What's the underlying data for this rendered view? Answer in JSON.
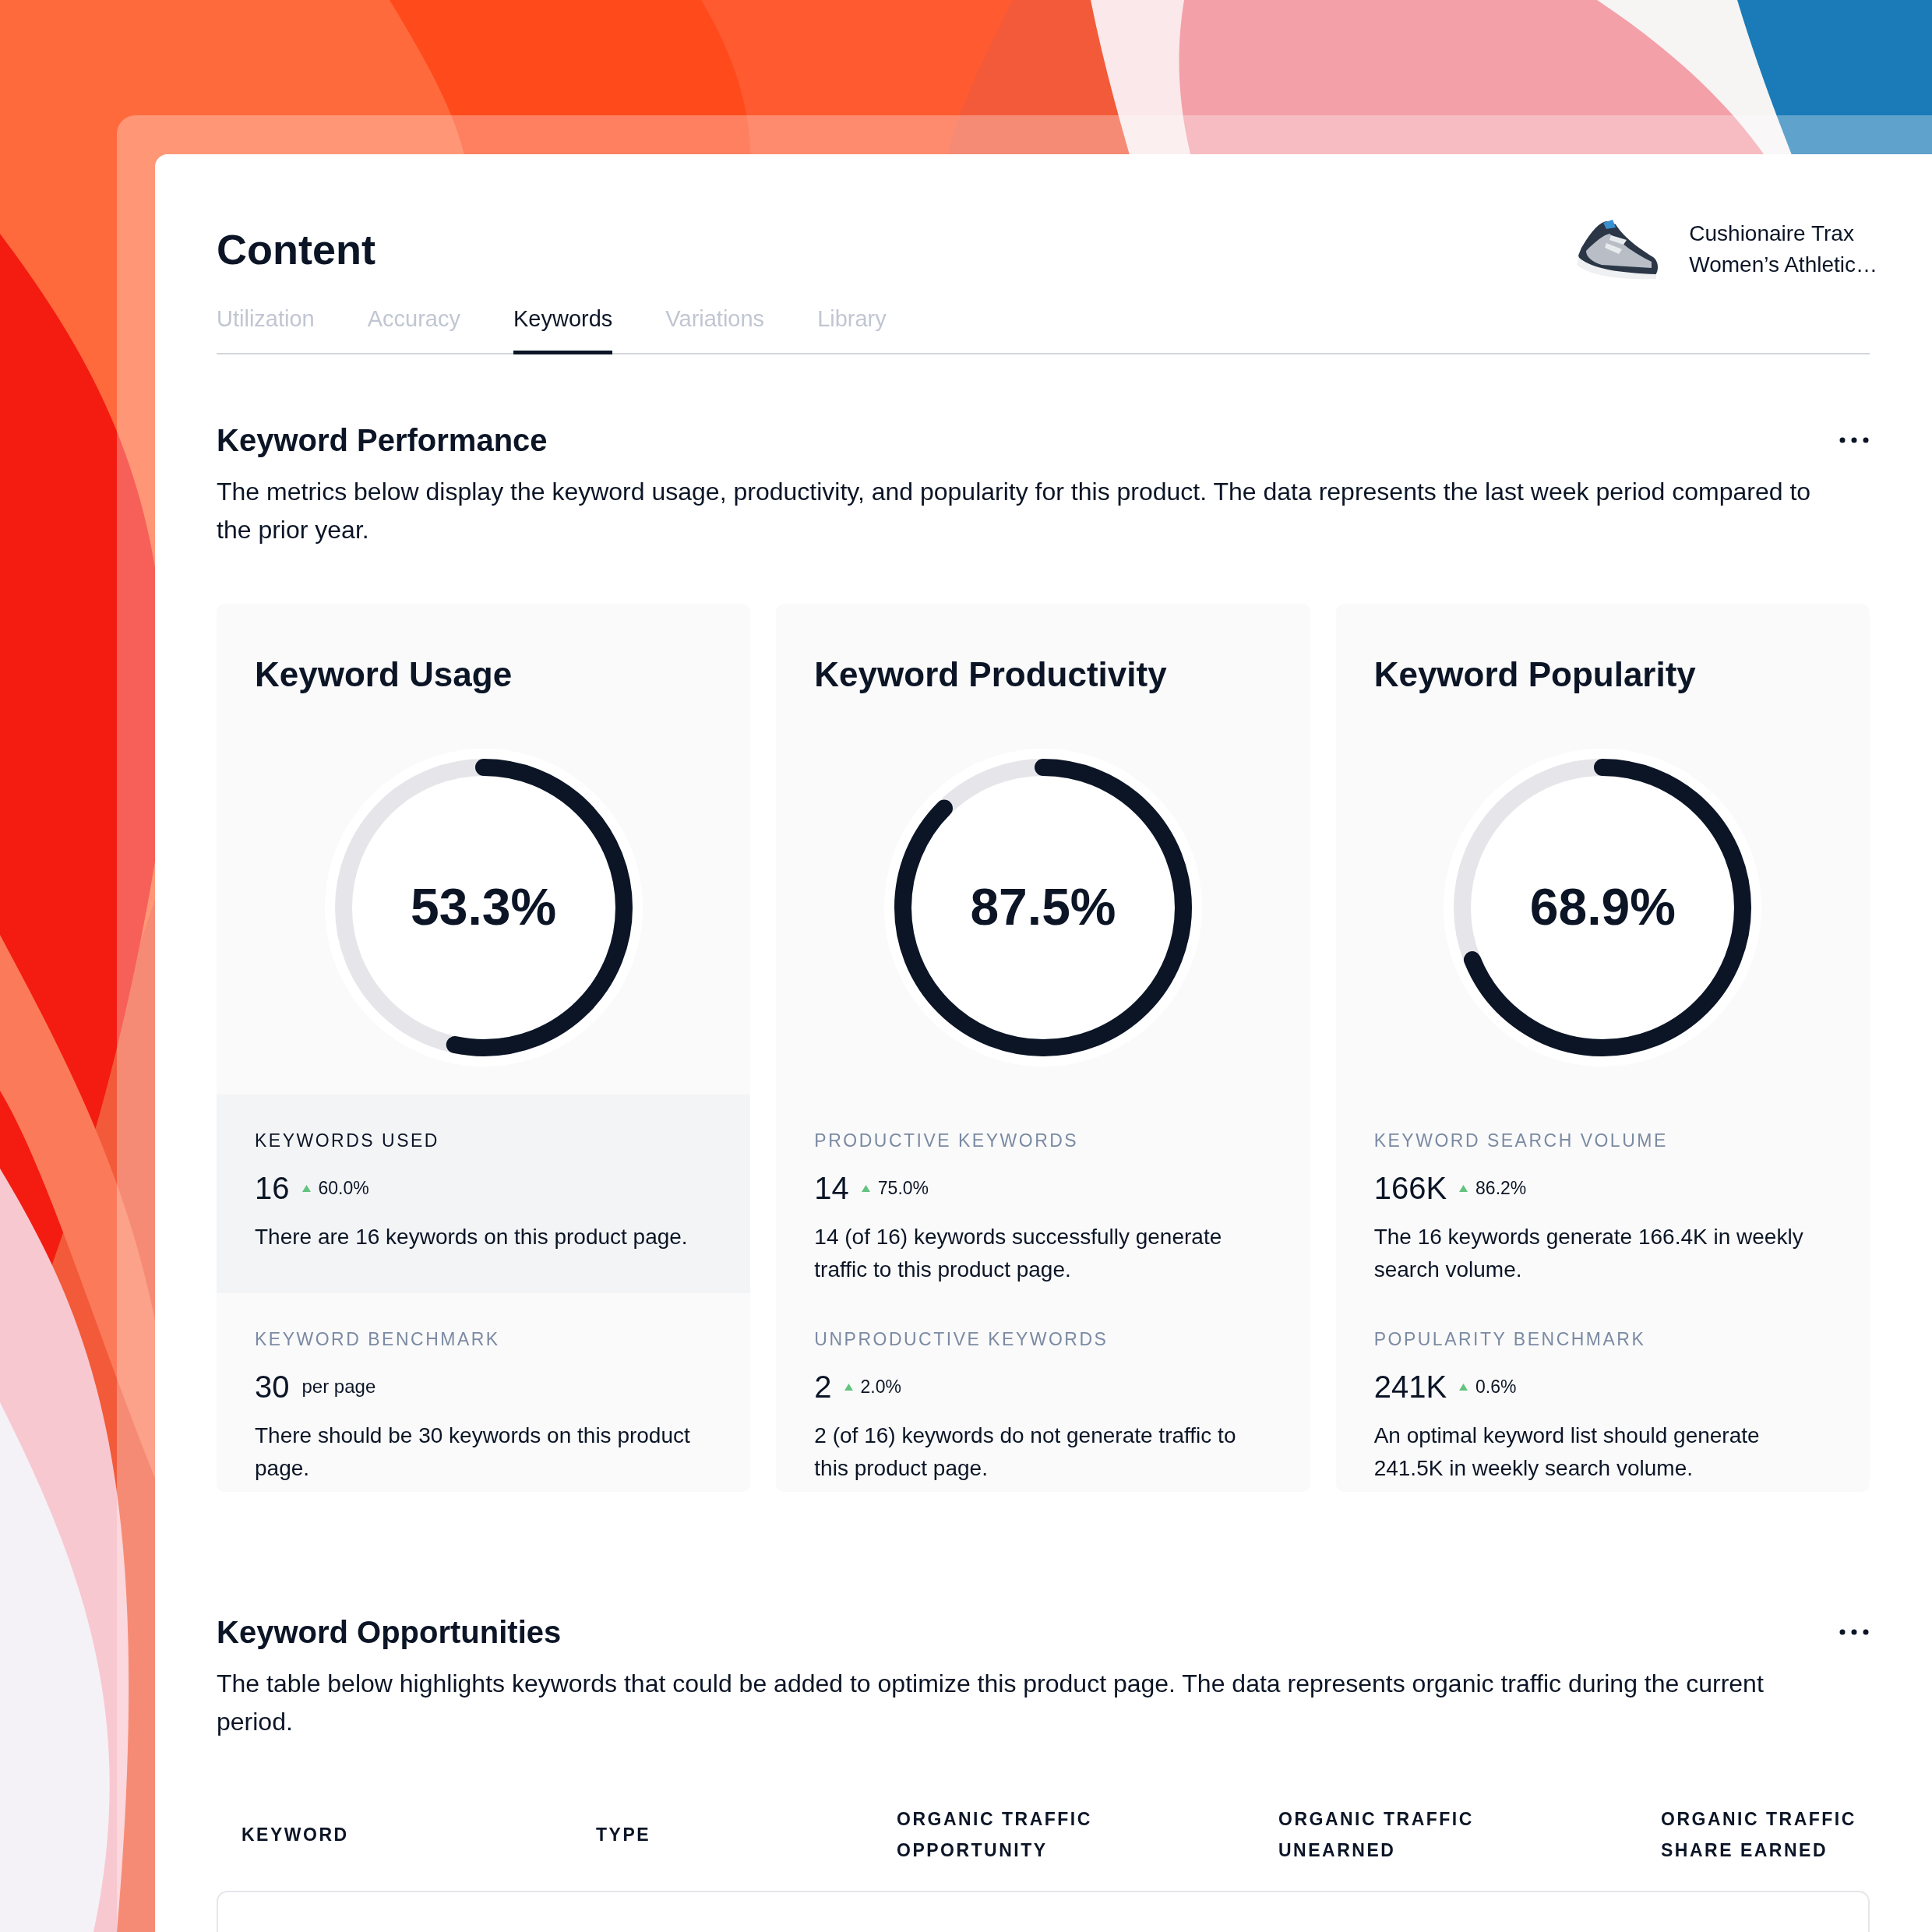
{
  "header": {
    "title": "Content",
    "product": {
      "lines": [
        "Cushionaire Trax",
        "Women’s Athletic…"
      ]
    }
  },
  "tabs": [
    {
      "label": "Utilization",
      "selected": false
    },
    {
      "label": "Accuracy",
      "selected": false
    },
    {
      "label": "Keywords",
      "selected": true
    },
    {
      "label": "Variations",
      "selected": false
    },
    {
      "label": "Library",
      "selected": false
    }
  ],
  "performance": {
    "title": "Keyword Performance",
    "description": "The metrics below display the keyword usage, productivity, and popularity for this product. The data represents the last week period compared to the prior year.",
    "cards": [
      {
        "title": "Keyword Usage",
        "level": 0.533,
        "reading": "53.3%",
        "stats": [
          {
            "label": "KEYWORDS USED",
            "value": "16",
            "kind": "rise",
            "delta": "60.0%",
            "description": "There are 16 keywords on this product page.",
            "selected": true
          },
          {
            "label": "KEYWORD BENCHMARK",
            "value": "30",
            "kind": "unit",
            "unit": "per page",
            "description": "There should be 30 keywords on this product page.",
            "selected": false
          }
        ]
      },
      {
        "title": "Keyword Productivity",
        "level": 0.875,
        "reading": "87.5%",
        "stats": [
          {
            "label": "PRODUCTIVE KEYWORDS",
            "value": "14",
            "kind": "rise",
            "delta": "75.0%",
            "description": "14 (of 16) keywords successfully generate traffic to this product page.",
            "selected": false
          },
          {
            "label": "UNPRODUCTIVE KEYWORDS",
            "value": "2",
            "kind": "rise",
            "delta": "2.0%",
            "description": "2 (of 16) keywords do not generate traffic to this product page.",
            "selected": false
          }
        ]
      },
      {
        "title": "Keyword Popularity",
        "level": 0.689,
        "reading": "68.9%",
        "stats": [
          {
            "label": "KEYWORD SEARCH VOLUME",
            "value": "166K",
            "kind": "rise",
            "delta": "86.2%",
            "description": "The 16 keywords generate 166.4K in weekly search volume.",
            "selected": false
          },
          {
            "label": "POPULARITY BENCHMARK",
            "value": "241K",
            "kind": "rise",
            "delta": "0.6%",
            "description": "An optimal keyword list should generate 241.5K in weekly search volume.",
            "selected": false
          }
        ]
      }
    ]
  },
  "opportunities": {
    "title": "Keyword Opportunities",
    "description": "The table below highlights keywords that could be added to optimize this product page. The data represents organic traffic during the current period.",
    "table": {
      "columns": [
        "KEYWORD",
        "TYPE",
        "ORGANIC TRAFFIC OPPORTUNITY",
        "ORGANIC TRAFFIC UNEARNED",
        "ORGANIC TRAFFIC SHARE EARNED"
      ]
    }
  }
}
